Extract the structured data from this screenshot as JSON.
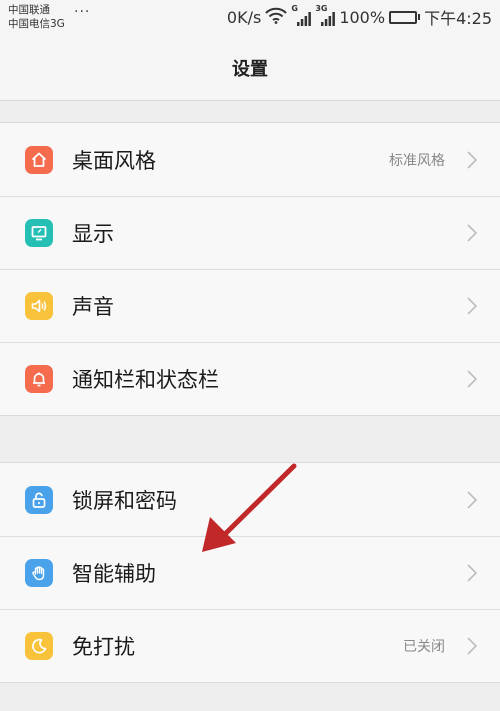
{
  "status_bar": {
    "carrier_1": "中国联通",
    "carrier_2": "中国电信3G",
    "more": "···",
    "net_speed": "0K/s",
    "signal_1_label": "G",
    "signal_2_label": "3G",
    "battery": "100%",
    "time": "下午4:25"
  },
  "header": {
    "title": "设置"
  },
  "groups": [
    {
      "items": [
        {
          "label": "桌面风格",
          "value": "标准风格",
          "icon": "home-icon",
          "color": "#f46b4e"
        },
        {
          "label": "显示",
          "icon": "display-icon",
          "color": "#26bfb6"
        },
        {
          "label": "声音",
          "icon": "speaker-icon",
          "color": "#f8c23a"
        },
        {
          "label": "通知栏和状态栏",
          "icon": "bell-icon",
          "color": "#f46b4e"
        }
      ]
    },
    {
      "items": [
        {
          "label": "锁屏和密码",
          "icon": "lock-icon",
          "color": "#4aa3ea"
        },
        {
          "label": "智能辅助",
          "icon": "hand-icon",
          "color": "#4aa3ea"
        },
        {
          "label": "免打扰",
          "value": "已关闭",
          "icon": "moon-icon",
          "color": "#f8c23a"
        }
      ]
    }
  ],
  "annotation": {
    "arrow_color": "#c0282a"
  }
}
